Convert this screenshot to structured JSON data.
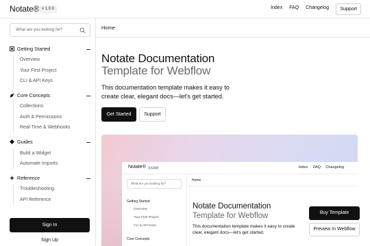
{
  "navbar": {
    "brand": "Notate®",
    "version": "v 1.0.0",
    "links": [
      "Index",
      "FAQ",
      "Changelog"
    ],
    "support": "Support"
  },
  "sidebar": {
    "search_placeholder": "What are you looking for?",
    "sections": [
      {
        "label": "Getting Started",
        "icon": "cube-icon",
        "items": [
          "Overview",
          "Your First Project",
          "CLI & API Keys"
        ]
      },
      {
        "label": "Core Concepts",
        "icon": "pen-icon",
        "items": [
          "Collections",
          "Auth & Permissions",
          "Real-Time & Webhooks"
        ]
      },
      {
        "label": "Guides",
        "icon": "diamond-icon",
        "items": [
          "Build a Widget",
          "Automate Imports"
        ]
      },
      {
        "label": "Reference",
        "icon": "sparkle-icon",
        "items": [
          "Troubleshooting",
          "API Reference"
        ]
      }
    ],
    "sign_in": "Sign In",
    "sign_up": "Sign Up"
  },
  "main": {
    "breadcrumb": "Home",
    "title_line1": "Notate Documentation",
    "title_line2": "Template for Webflow",
    "description": "This documentation template makes it easy to create clear, elegant docs—let's get started.",
    "primary_button": "Get Started",
    "secondary_button": "Support"
  },
  "preview": {
    "brand": "Notate®",
    "version": "v 1.0.0",
    "links": [
      "Index",
      "FAQ",
      "Changelog"
    ],
    "search_placeholder": "What are you looking for?",
    "breadcrumb": "Home",
    "section1": "Getting Started",
    "section1_items": [
      "Overview",
      "Your First Project",
      "CLI & API Keys"
    ],
    "section2": "Core Concepts",
    "title_line1": "Notate Documentation",
    "title_line2": "Template for Webflow",
    "description": "This documentation template makes it easy to create clear, elegant docs—let's get started."
  },
  "floating": {
    "buy": "Buy Template",
    "webflow": "Preview In Webflow"
  }
}
